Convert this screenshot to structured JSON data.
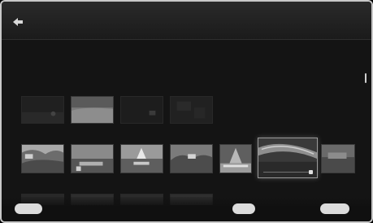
{
  "header": {
    "title": "",
    "subtitle_bold": "",
    "subtitle_rest": ""
  },
  "section": {
    "label": ""
  },
  "footer": {
    "left_button": "",
    "left_label": "",
    "mid_button": "",
    "mid_label": "",
    "right_button": "",
    "right_label": ""
  },
  "colors": {
    "background": "#141414",
    "topbar": "#222222",
    "frame": "#c8c8c8",
    "pill": "#dcdcdc"
  },
  "icons": {
    "back": "back-arrow-icon"
  },
  "rows": {
    "top_count": 4,
    "main_count": 7,
    "focused_index": 5
  }
}
